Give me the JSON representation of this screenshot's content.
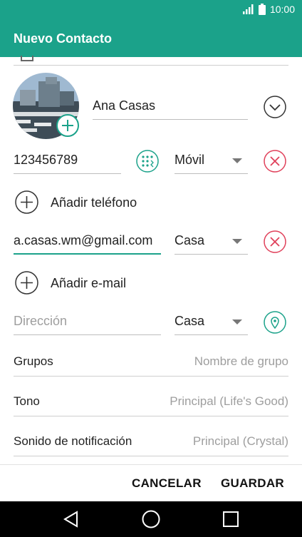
{
  "status_bar": {
    "time": "10:00"
  },
  "app_bar": {
    "title": "Nuevo Contacto"
  },
  "name": {
    "value": "Ana Casas"
  },
  "phone": {
    "value": "123456789",
    "type": "Móvil"
  },
  "add_phone": {
    "label": "Añadir teléfono"
  },
  "email": {
    "value": "a.casas.wm@gmail.com",
    "type": "Casa"
  },
  "add_email": {
    "label": "Añadir e-mail"
  },
  "address": {
    "placeholder": "Dirección",
    "type": "Casa"
  },
  "groups": {
    "label": "Grupos",
    "value": "Nombre de grupo"
  },
  "ringtone": {
    "label": "Tono",
    "value": "Principal (Life's Good)"
  },
  "notification_sound": {
    "label": "Sonido de notificación",
    "value": "Principal (Crystal)"
  },
  "actions": {
    "cancel": "CANCELAR",
    "save": "GUARDAR"
  },
  "colors": {
    "accent": "#1ba28a",
    "delete": "#e0405a"
  }
}
